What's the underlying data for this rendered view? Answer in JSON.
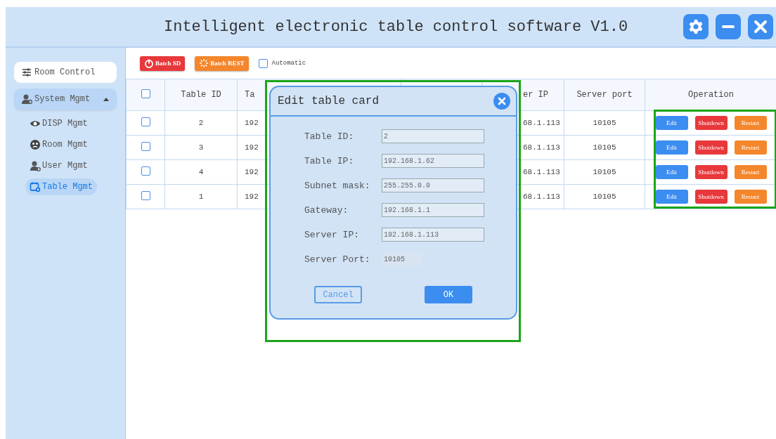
{
  "window": {
    "title": "Intelligent electronic table control software V1.0"
  },
  "title_buttons": [
    {
      "kind": "settings"
    },
    {
      "kind": "minimize"
    },
    {
      "kind": "close"
    }
  ],
  "sidebar": {
    "items": [
      {
        "label": "Room Control",
        "selected": false
      },
      {
        "label": "System Mgmt",
        "selected": true,
        "expanded": true,
        "children": [
          {
            "label": "DISP Mgmt",
            "selected": false
          },
          {
            "label": "Room Mgmt",
            "selected": false
          },
          {
            "label": "User Mgmt",
            "selected": false
          },
          {
            "label": "Table Mgmt",
            "selected": true
          }
        ]
      }
    ]
  },
  "toolbar": {
    "buttons": [
      {
        "label": "Batch SD",
        "kind": "danger"
      },
      {
        "label": "Batch REST",
        "kind": "warning"
      }
    ],
    "automatic": {
      "label": "Automatic",
      "checked": false
    }
  },
  "table": {
    "header_checked": false,
    "operations_highlighted": true,
    "columns": [
      {
        "label": "Table ID"
      },
      {
        "label": "Ta"
      },
      {
        "label": "er IP"
      },
      {
        "label": "Server port"
      },
      {
        "label": "Operation"
      }
    ],
    "rows": [
      {
        "checked": false,
        "cells": [
          "2",
          "192",
          "68.1.113",
          "10105"
        ],
        "actions": [
          {
            "label": "Edit",
            "kind": "edit"
          },
          {
            "label": "Shutdown",
            "kind": "shutdown"
          },
          {
            "label": "Restart",
            "kind": "restart"
          }
        ]
      },
      {
        "checked": false,
        "cells": [
          "3",
          "192",
          "68.1.113",
          "10105"
        ],
        "actions": [
          {
            "label": "Edit",
            "kind": "edit"
          },
          {
            "label": "Shutdown",
            "kind": "shutdown"
          },
          {
            "label": "Restart",
            "kind": "restart"
          }
        ]
      },
      {
        "checked": false,
        "cells": [
          "4",
          "192",
          "68.1.113",
          "10105"
        ],
        "actions": [
          {
            "label": "Edit",
            "kind": "edit"
          },
          {
            "label": "Shutdown",
            "kind": "shutdown"
          },
          {
            "label": "Restart",
            "kind": "restart"
          }
        ]
      },
      {
        "checked": false,
        "cells": [
          "1",
          "192",
          "68.1.113",
          "10105"
        ],
        "actions": [
          {
            "label": "Edit",
            "kind": "edit"
          },
          {
            "label": "Shutdown",
            "kind": "shutdown"
          },
          {
            "label": "Restart",
            "kind": "restart"
          }
        ]
      }
    ]
  },
  "dialog": {
    "title": "Edit table card",
    "highlighted": true,
    "fields": [
      {
        "label": "Table ID:",
        "value": "2",
        "disabled": false
      },
      {
        "label": "Table IP:",
        "value": "192.168.1.62",
        "disabled": false
      },
      {
        "label": "Subnet mask:",
        "value": "255.255.0.0",
        "disabled": false
      },
      {
        "label": "Gateway:",
        "value": "192.168.1.1",
        "disabled": false
      },
      {
        "label": "Server IP:",
        "value": "192.168.1.113",
        "disabled": false
      },
      {
        "label": "Server Port:",
        "value": "10105",
        "disabled": true
      }
    ],
    "buttons": [
      {
        "label": "Cancel",
        "kind": "secondary"
      },
      {
        "label": "OK",
        "kind": "primary"
      }
    ]
  }
}
